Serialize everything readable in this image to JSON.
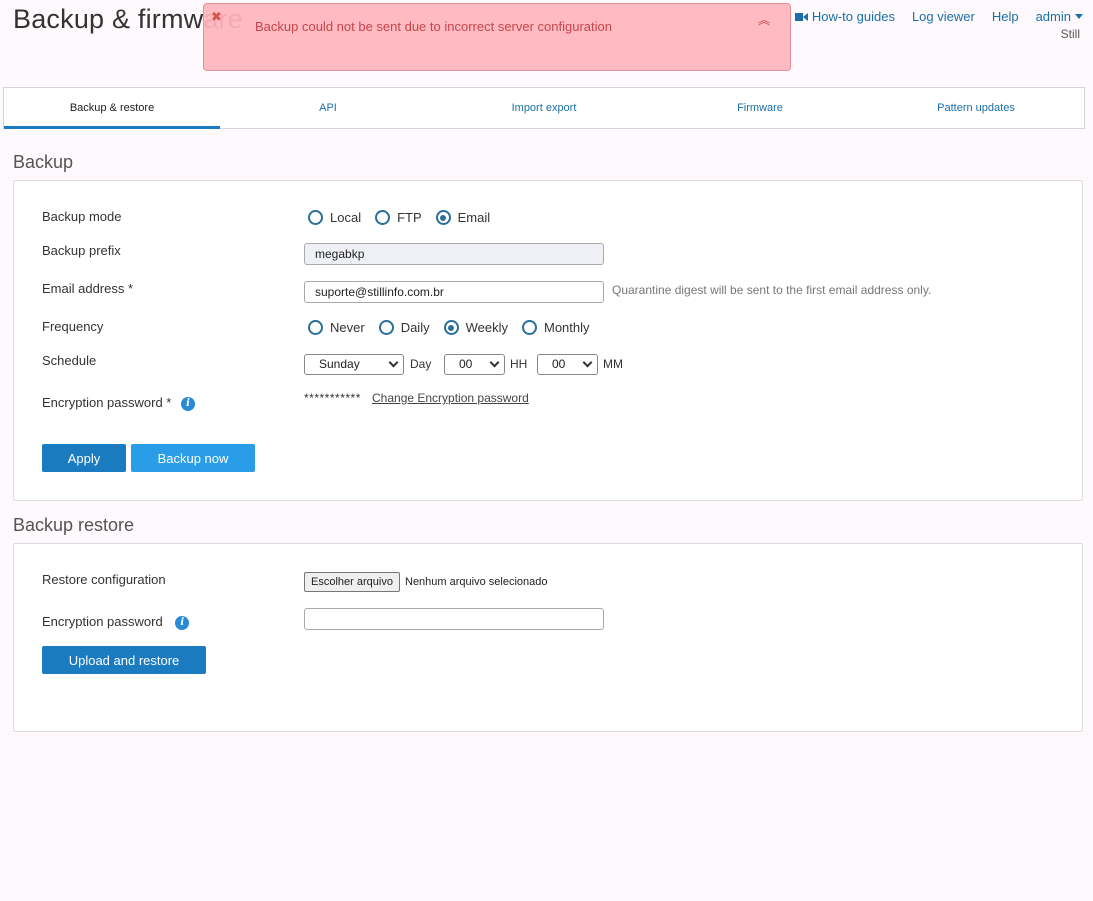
{
  "header": {
    "title": "Backup & firmware",
    "links": {
      "howto": "How-to guides",
      "logviewer": "Log viewer",
      "help": "Help",
      "admin": "admin"
    },
    "org": "Still"
  },
  "toast": {
    "message": "Backup could not be sent due to incorrect server configuration",
    "close_glyph": "✖",
    "collapse_glyph": "︽"
  },
  "tabs": [
    {
      "label": "Backup & restore",
      "active": true
    },
    {
      "label": "API",
      "active": false
    },
    {
      "label": "Import export",
      "active": false
    },
    {
      "label": "Firmware",
      "active": false
    },
    {
      "label": "Pattern updates",
      "active": false
    }
  ],
  "backup": {
    "title": "Backup",
    "mode": {
      "label": "Backup mode",
      "options": [
        "Local",
        "FTP",
        "Email"
      ],
      "selected": "Email"
    },
    "prefix": {
      "label": "Backup prefix",
      "value": "megabkp"
    },
    "email": {
      "label": "Email address *",
      "value": "suporte@stillinfo.com.br",
      "hint": "Quarantine digest will be sent to the first email address only."
    },
    "frequency": {
      "label": "Frequency",
      "options": [
        "Never",
        "Daily",
        "Weekly",
        "Monthly"
      ],
      "selected": "Weekly"
    },
    "schedule": {
      "label": "Schedule",
      "day_value": "Sunday",
      "day_label": "Day",
      "hour_value": "00",
      "hour_label": "HH",
      "minute_value": "00",
      "minute_label": "MM"
    },
    "encryption": {
      "label": "Encryption password *",
      "info_glyph": "i",
      "masked": "***********",
      "change_link": "Change Encryption password"
    },
    "apply_label": "Apply",
    "backup_now_label": "Backup now"
  },
  "restore": {
    "title": "Backup restore",
    "config": {
      "label": "Restore configuration",
      "button": "Escolher arquivo",
      "status": "Nenhum arquivo selecionado"
    },
    "encryption": {
      "label": "Encryption password",
      "info_glyph": "i",
      "value": ""
    },
    "upload_label": "Upload and restore"
  },
  "colors": {
    "accent": "#1b7bc1",
    "link": "#1b6fa8",
    "toast_bg": "#ffb6bc",
    "toast_text": "#c7454c"
  }
}
